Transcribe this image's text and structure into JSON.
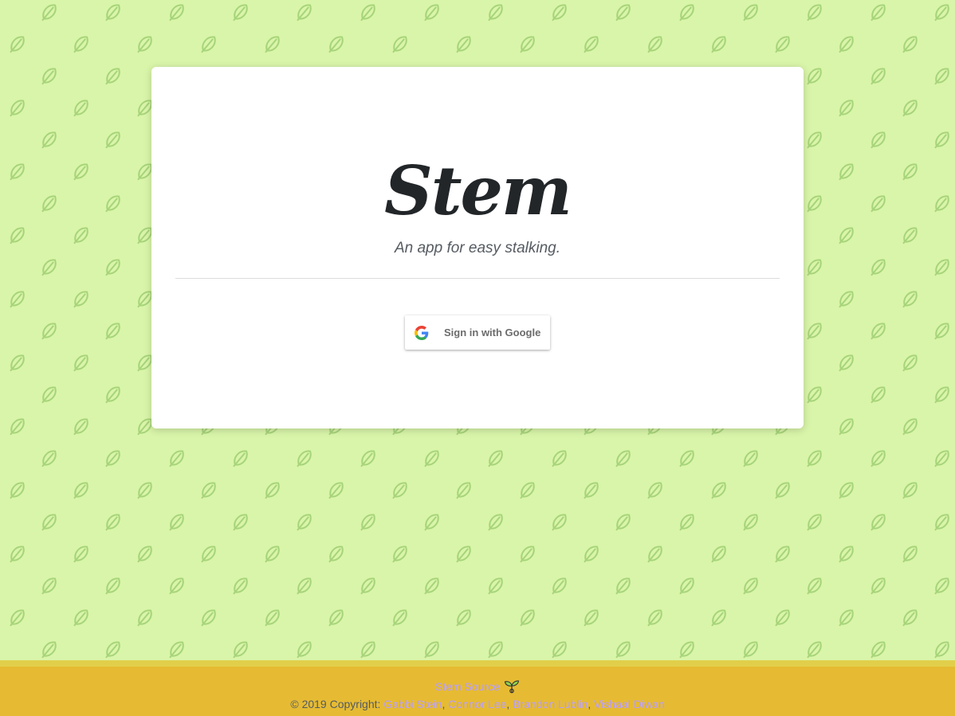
{
  "page": {
    "background_color": "#d9f5a9",
    "leaf_pattern_color": "#a7d47a"
  },
  "card": {
    "logo_text": "Stem",
    "tagline": "An app for easy stalking.",
    "signin_button": {
      "label": "Sign in with Google",
      "icon": "google-g-icon"
    }
  },
  "footer": {
    "source_link": "Stem Source",
    "source_icon": "sprout-icon",
    "copyright_prefix": "© 2019 Copyright:",
    "authors": [
      "Gabbi Stein",
      "Connor Lee",
      "Brandon Lublin",
      "Vishaal Diwan"
    ],
    "separator": ",",
    "background_color": "#e6bb33",
    "link_color": "#b59cff"
  }
}
